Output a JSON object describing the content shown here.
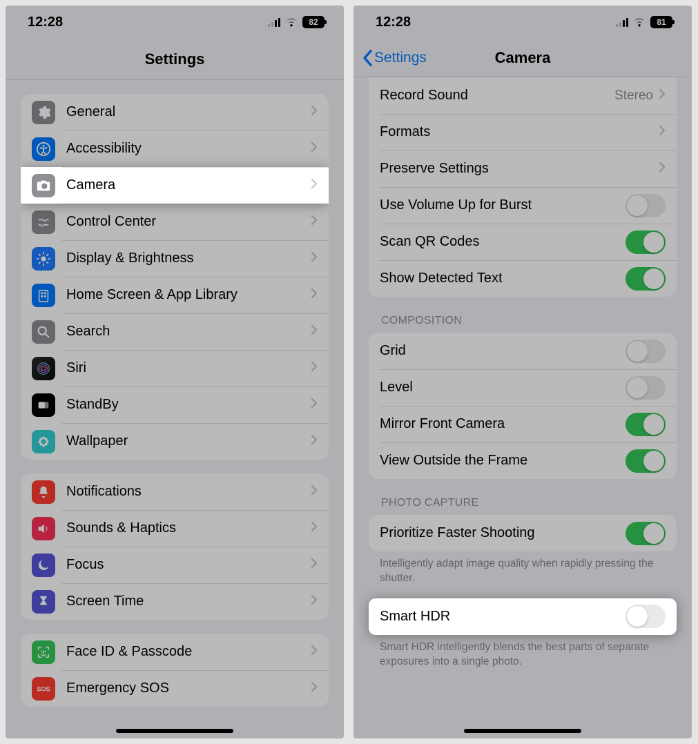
{
  "left": {
    "status": {
      "time": "12:28",
      "battery": "82"
    },
    "title": "Settings",
    "group1": [
      {
        "id": "general",
        "label": "General",
        "icon": "gear",
        "bg": "bg-gray"
      },
      {
        "id": "accessibility",
        "label": "Accessibility",
        "icon": "accessibility",
        "bg": "bg-blue"
      },
      {
        "id": "camera",
        "label": "Camera",
        "icon": "camera",
        "bg": "bg-gray",
        "highlight": true
      },
      {
        "id": "control-center",
        "label": "Control Center",
        "icon": "sliders",
        "bg": "bg-darkgray"
      },
      {
        "id": "display",
        "label": "Display & Brightness",
        "icon": "sun",
        "bg": "bg-brightblue"
      },
      {
        "id": "home-screen",
        "label": "Home Screen & App Library",
        "icon": "apps",
        "bg": "bg-blue"
      },
      {
        "id": "search",
        "label": "Search",
        "icon": "search",
        "bg": "bg-search"
      },
      {
        "id": "siri",
        "label": "Siri",
        "icon": "siri",
        "bg": "bg-siri"
      },
      {
        "id": "standby",
        "label": "StandBy",
        "icon": "standby",
        "bg": "bg-black"
      },
      {
        "id": "wallpaper",
        "label": "Wallpaper",
        "icon": "flower",
        "bg": "bg-teal"
      }
    ],
    "group2": [
      {
        "id": "notifications",
        "label": "Notifications",
        "icon": "bell",
        "bg": "bg-red"
      },
      {
        "id": "sounds",
        "label": "Sounds & Haptics",
        "icon": "speaker",
        "bg": "bg-pink"
      },
      {
        "id": "focus",
        "label": "Focus",
        "icon": "moon",
        "bg": "bg-indigo"
      },
      {
        "id": "screentime",
        "label": "Screen Time",
        "icon": "hourglass",
        "bg": "bg-indigo"
      }
    ],
    "group3": [
      {
        "id": "faceid",
        "label": "Face ID & Passcode",
        "icon": "faceid",
        "bg": "bg-green"
      },
      {
        "id": "sos",
        "label": "Emergency SOS",
        "icon": "sos",
        "bg": "bg-red"
      }
    ]
  },
  "right": {
    "status": {
      "time": "12:28",
      "battery": "81"
    },
    "back": "Settings",
    "title": "Camera",
    "section1": [
      {
        "id": "record-sound",
        "label": "Record Sound",
        "type": "link",
        "detail": "Stereo"
      },
      {
        "id": "formats",
        "label": "Formats",
        "type": "link"
      },
      {
        "id": "preserve",
        "label": "Preserve Settings",
        "type": "link"
      },
      {
        "id": "vol-up",
        "label": "Use Volume Up for Burst",
        "type": "toggle",
        "on": false
      },
      {
        "id": "qr",
        "label": "Scan QR Codes",
        "type": "toggle",
        "on": true
      },
      {
        "id": "detected-text",
        "label": "Show Detected Text",
        "type": "toggle",
        "on": true
      }
    ],
    "composition_header": "Composition",
    "composition": [
      {
        "id": "grid",
        "label": "Grid",
        "type": "toggle",
        "on": false
      },
      {
        "id": "level",
        "label": "Level",
        "type": "toggle",
        "on": false
      },
      {
        "id": "mirror",
        "label": "Mirror Front Camera",
        "type": "toggle",
        "on": true
      },
      {
        "id": "outside-frame",
        "label": "View Outside the Frame",
        "type": "toggle",
        "on": true
      }
    ],
    "photo_header": "Photo Capture",
    "photo1": [
      {
        "id": "prioritize",
        "label": "Prioritize Faster Shooting",
        "type": "toggle",
        "on": true
      }
    ],
    "photo1_footer": "Intelligently adapt image quality when rapidly pressing the shutter.",
    "photo2": [
      {
        "id": "smarthdr",
        "label": "Smart HDR",
        "type": "toggle",
        "on": false,
        "highlight": true
      }
    ],
    "photo2_footer": "Smart HDR intelligently blends the best parts of separate exposures into a single photo."
  }
}
